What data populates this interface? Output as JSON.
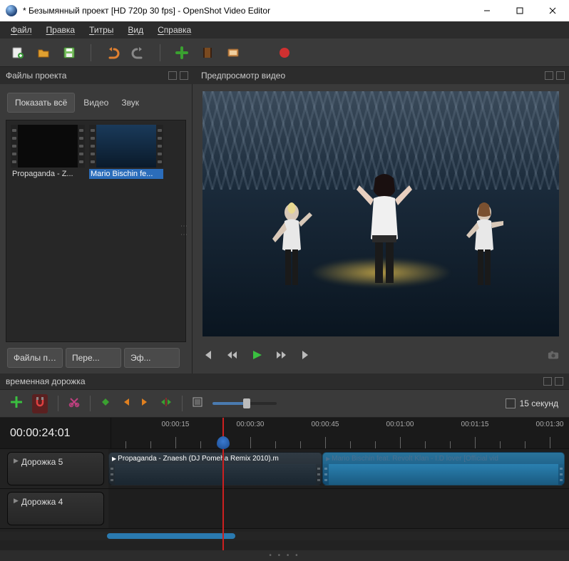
{
  "titlebar": {
    "title": "* Безымянный проект [HD 720p 30 fps] - OpenShot Video Editor"
  },
  "menubar": {
    "items": [
      "Файл",
      "Правка",
      "Титры",
      "Вид",
      "Справка"
    ]
  },
  "panels": {
    "project_files_title": "Файлы проекта",
    "preview_title": "Предпросмотр видео"
  },
  "filter_tabs": {
    "show_all": "Показать всё",
    "video": "Видео",
    "audio": "Звук"
  },
  "thumbnails": [
    {
      "label": "Propaganda  - Z...",
      "selected": false
    },
    {
      "label": "Mario Bischin fe...",
      "selected": true
    }
  ],
  "bottom_tabs": {
    "files": "Файлы пр...",
    "transitions": "Пере...",
    "effects": "Эф..."
  },
  "timeline": {
    "title": "временная дорожка",
    "zoom_label": "15 секунд",
    "timecode": "00:00:24:01",
    "ticks": [
      "00:00:15",
      "00:00:30",
      "00:00:45",
      "00:01:00",
      "00:01:15",
      "00:01:30"
    ],
    "tracks": [
      {
        "name": "Дорожка 5"
      },
      {
        "name": "Дорожка 4"
      }
    ],
    "clips": [
      {
        "title": "Propaganda - Znaesh (DJ Pomeha Remix 2010).m"
      },
      {
        "title": "Mario Bischin feat. Revolt Klan - I.D lover [Official vid"
      }
    ]
  }
}
